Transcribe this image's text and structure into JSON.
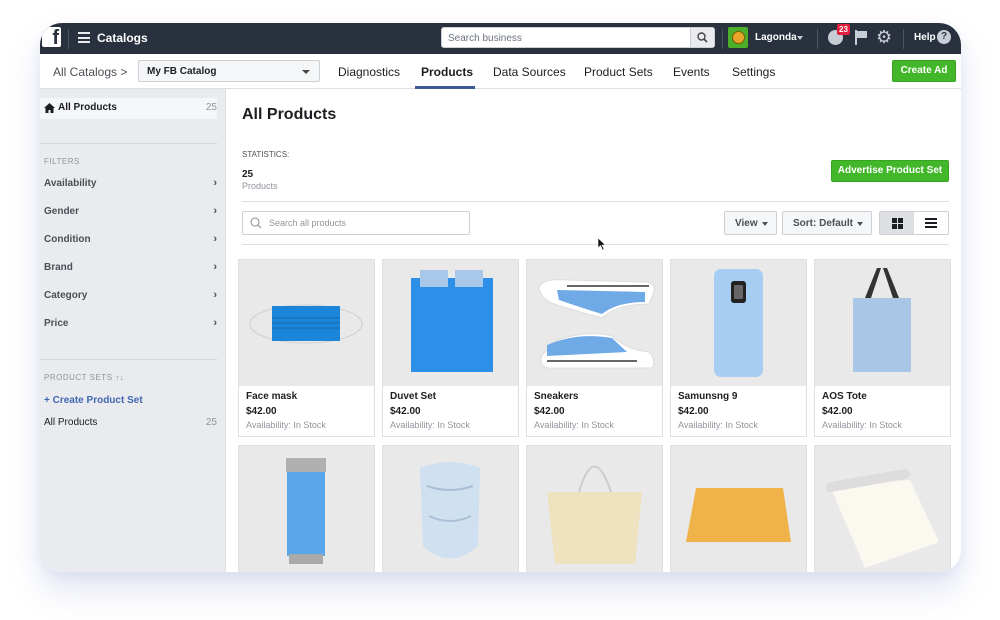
{
  "topbar": {
    "app_title": "Catalogs",
    "search_placeholder": "Search business",
    "user_name": "Lagonda",
    "notification_count": "23",
    "help_label": "Help",
    "help_glyph": "?"
  },
  "subnav": {
    "breadcrumb": "All Catalogs >",
    "catalog_selected": "My FB Catalog",
    "tabs": [
      {
        "label": "Diagnostics",
        "active": false
      },
      {
        "label": "Products",
        "active": true
      },
      {
        "label": "Data Sources",
        "active": false
      },
      {
        "label": "Product Sets",
        "active": false
      },
      {
        "label": "Events",
        "active": false
      },
      {
        "label": "Settings",
        "active": false
      }
    ],
    "create_ad_label": "Create Ad"
  },
  "sidebar": {
    "all_products_label": "All Products",
    "all_products_count": "25",
    "filters_heading": "FILTERS",
    "filters": [
      {
        "label": "Availability"
      },
      {
        "label": "Gender"
      },
      {
        "label": "Condition"
      },
      {
        "label": "Brand"
      },
      {
        "label": "Category"
      },
      {
        "label": "Price"
      }
    ],
    "product_sets_heading": "PRODUCT SETS ↑↓",
    "create_set_label": "+ Create Product Set",
    "sets": [
      {
        "label": "All Products",
        "count": "25"
      }
    ]
  },
  "main": {
    "title": "All Products",
    "stats_label": "STATISTICS:",
    "stats_value": "25",
    "stats_unit": "Products",
    "advertise_label": "Advertise Product Set",
    "search_placeholder": "Search all products",
    "view_label": "View",
    "sort_label": "Sort: Default",
    "view_mode": "grid"
  },
  "products": [
    {
      "name": "Face mask",
      "price": "$42.00",
      "availability": "Availability: In Stock",
      "image": "face-mask"
    },
    {
      "name": "Duvet Set",
      "price": "$42.00",
      "availability": "Availability: In Stock",
      "image": "duvet"
    },
    {
      "name": "Sneakers",
      "price": "$42.00",
      "availability": "Availability: In Stock",
      "image": "sneakers"
    },
    {
      "name": "Samunsng 9",
      "price": "$42.00",
      "availability": "Availability: In Stock",
      "image": "phone-case"
    },
    {
      "name": "AOS Tote",
      "price": "$42.00",
      "availability": "Availability: In Stock",
      "image": "tote"
    },
    {
      "name": "",
      "price": "",
      "availability": "",
      "image": "tumbler"
    },
    {
      "name": "",
      "price": "",
      "availability": "",
      "image": "neck-gaiter"
    },
    {
      "name": "",
      "price": "",
      "availability": "",
      "image": "beach-bag"
    },
    {
      "name": "",
      "price": "",
      "availability": "",
      "image": "mat"
    },
    {
      "name": "",
      "price": "",
      "availability": "",
      "image": "paper-roll"
    }
  ],
  "colors": {
    "topbar": "#29313f",
    "accent_green": "#42b72a",
    "tab_underline": "#3b5998",
    "link_blue": "#4267b2",
    "sidebar_bg": "#e9ebee",
    "badge_red": "#e41e3f"
  }
}
